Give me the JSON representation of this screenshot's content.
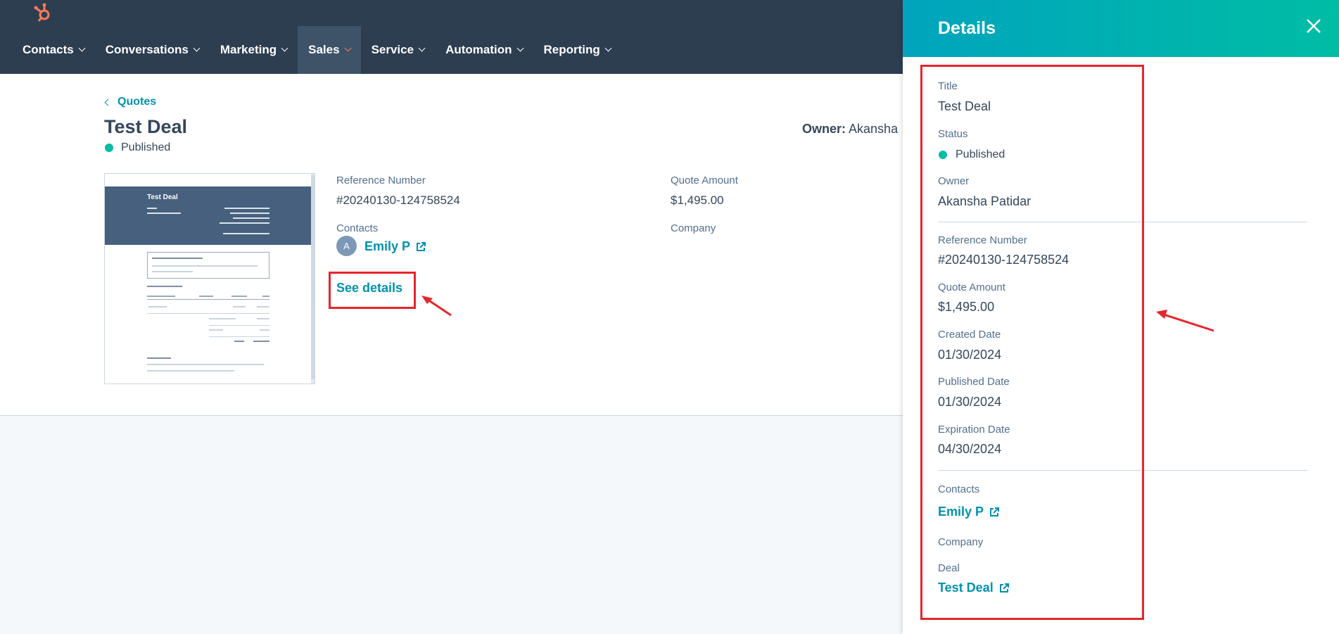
{
  "nav": {
    "items": [
      {
        "label": "Contacts"
      },
      {
        "label": "Conversations"
      },
      {
        "label": "Marketing"
      },
      {
        "label": "Sales"
      },
      {
        "label": "Service"
      },
      {
        "label": "Automation"
      },
      {
        "label": "Reporting"
      }
    ],
    "active": "Sales"
  },
  "quote": {
    "back_label": "Quotes",
    "title": "Test Deal",
    "status": "Published",
    "owner_label": "Owner:",
    "owner_name": "Akansha",
    "reference_label": "Reference Number",
    "reference_value": "#20240130-124758524",
    "amount_label": "Quote Amount",
    "amount_value": "$1,495.00",
    "contacts_label": "Contacts",
    "contact_avatar": "A",
    "contact_name": "Emily P",
    "company_label": "Company",
    "see_details": "See details",
    "thumbnail_title": "Test Deal"
  },
  "panel": {
    "title": "Details",
    "title_label": "Title",
    "title_value": "Test Deal",
    "status_label": "Status",
    "status_value": "Published",
    "owner_label": "Owner",
    "owner_value": "Akansha Patidar",
    "reference_label": "Reference Number",
    "reference_value": "#20240130-124758524",
    "amount_label": "Quote Amount",
    "amount_value": "$1,495.00",
    "created_label": "Created Date",
    "created_value": "01/30/2024",
    "published_label": "Published Date",
    "published_value": "01/30/2024",
    "expiration_label": "Expiration Date",
    "expiration_value": "04/30/2024",
    "contacts_label": "Contacts",
    "contact_value": "Emily P",
    "company_label": "Company",
    "deal_label": "Deal",
    "deal_value": "Test Deal"
  },
  "colors": {
    "nav_bg": "#2d3e50",
    "link": "#0091ae",
    "status_dot": "#00bda5",
    "annotation": "#e5262b",
    "panel_header_start": "#00a4bd",
    "panel_header_end": "#00bda5"
  }
}
